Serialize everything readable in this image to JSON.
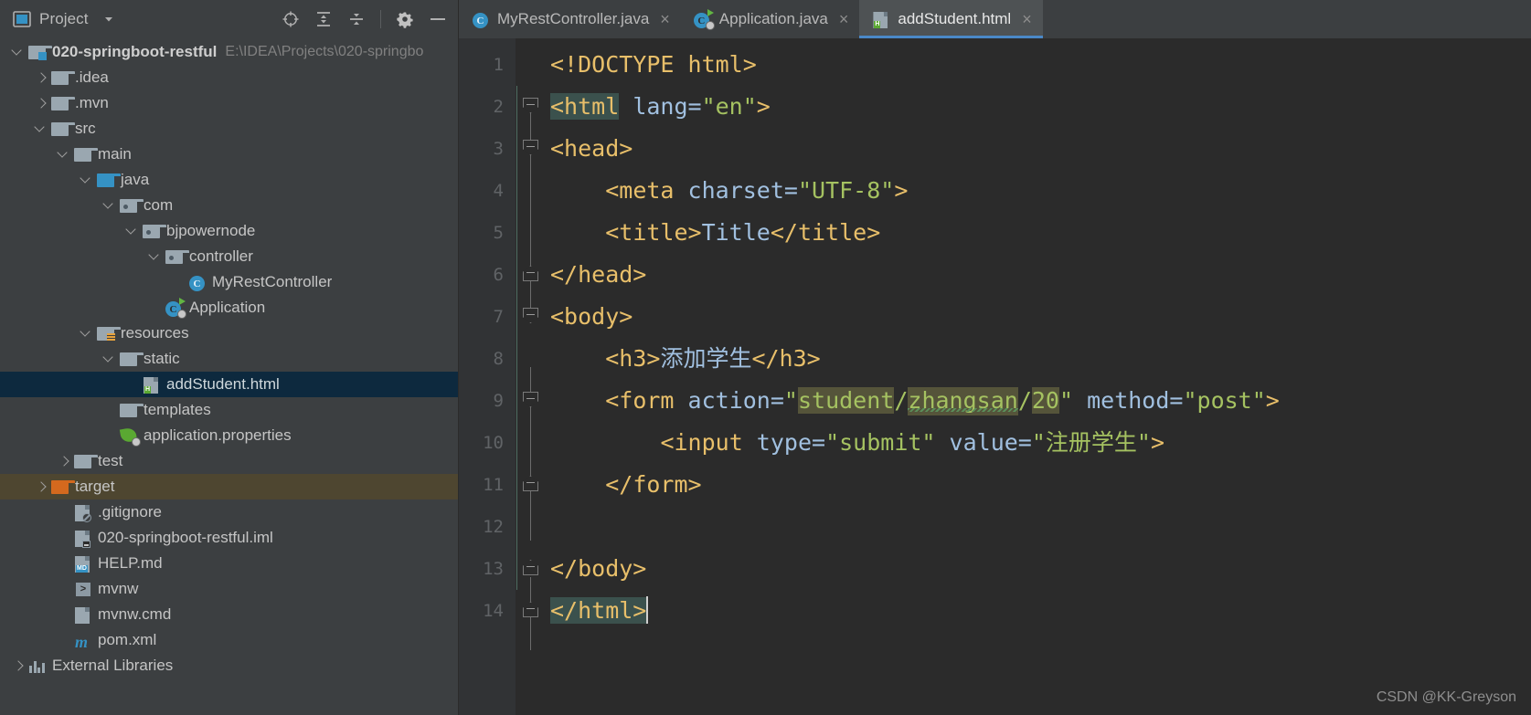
{
  "panel": {
    "title": "Project",
    "dropdown_icon": "chevron-down-icon",
    "tools": [
      {
        "name": "locate-icon",
        "label": "Select Opened File"
      },
      {
        "name": "expand-all-icon",
        "label": "Expand All"
      },
      {
        "name": "collapse-all-icon",
        "label": "Collapse All"
      },
      {
        "name": "gear-icon",
        "label": "Settings"
      },
      {
        "name": "minimize-icon",
        "label": "Hide"
      }
    ]
  },
  "tree": [
    {
      "label": "020-springboot-restful",
      "path": "E:\\IDEA\\Projects\\020-springbo",
      "indent": 0,
      "arrow": "expanded",
      "icon": "module-folder-icon",
      "bold": true,
      "state": "normal"
    },
    {
      "label": ".idea",
      "path": "",
      "indent": 1,
      "arrow": "collapsed",
      "icon": "folder-icon",
      "bold": false,
      "state": "normal"
    },
    {
      "label": ".mvn",
      "path": "",
      "indent": 1,
      "arrow": "collapsed",
      "icon": "folder-icon",
      "bold": false,
      "state": "normal"
    },
    {
      "label": "src",
      "path": "",
      "indent": 1,
      "arrow": "expanded",
      "icon": "folder-icon",
      "bold": false,
      "state": "normal"
    },
    {
      "label": "main",
      "path": "",
      "indent": 2,
      "arrow": "expanded",
      "icon": "folder-icon",
      "bold": false,
      "state": "normal"
    },
    {
      "label": "java",
      "path": "",
      "indent": 3,
      "arrow": "expanded",
      "icon": "source-folder-icon",
      "bold": false,
      "state": "normal"
    },
    {
      "label": "com",
      "path": "",
      "indent": 4,
      "arrow": "expanded",
      "icon": "package-icon",
      "bold": false,
      "state": "normal"
    },
    {
      "label": "bjpowernode",
      "path": "",
      "indent": 5,
      "arrow": "expanded",
      "icon": "package-icon",
      "bold": false,
      "state": "normal"
    },
    {
      "label": "controller",
      "path": "",
      "indent": 6,
      "arrow": "expanded",
      "icon": "package-icon",
      "bold": false,
      "state": "normal"
    },
    {
      "label": "MyRestController",
      "path": "",
      "indent": 7,
      "arrow": "none",
      "icon": "java-class-icon",
      "bold": false,
      "state": "normal"
    },
    {
      "label": "Application",
      "path": "",
      "indent": 6,
      "arrow": "none",
      "icon": "spring-boot-class-icon",
      "bold": false,
      "state": "normal"
    },
    {
      "label": "resources",
      "path": "",
      "indent": 3,
      "arrow": "expanded",
      "icon": "resources-folder-icon",
      "bold": false,
      "state": "normal"
    },
    {
      "label": "static",
      "path": "",
      "indent": 4,
      "arrow": "expanded",
      "icon": "folder-icon",
      "bold": false,
      "state": "normal"
    },
    {
      "label": "addStudent.html",
      "path": "",
      "indent": 5,
      "arrow": "none",
      "icon": "html-file-icon",
      "bold": false,
      "state": "selected"
    },
    {
      "label": "templates",
      "path": "",
      "indent": 4,
      "arrow": "none",
      "icon": "folder-icon",
      "bold": false,
      "state": "normal"
    },
    {
      "label": "application.properties",
      "path": "",
      "indent": 4,
      "arrow": "none",
      "icon": "spring-properties-icon",
      "bold": false,
      "state": "normal"
    },
    {
      "label": "test",
      "path": "",
      "indent": 2,
      "arrow": "collapsed",
      "icon": "folder-icon",
      "bold": false,
      "state": "normal"
    },
    {
      "label": "target",
      "path": "",
      "indent": 1,
      "arrow": "collapsed",
      "icon": "excluded-folder-icon",
      "bold": false,
      "state": "highlighted"
    },
    {
      "label": ".gitignore",
      "path": "",
      "indent": 2,
      "arrow": "none",
      "icon": "gitignore-file-icon",
      "bold": false,
      "state": "normal"
    },
    {
      "label": "020-springboot-restful.iml",
      "path": "",
      "indent": 2,
      "arrow": "none",
      "icon": "iml-file-icon",
      "bold": false,
      "state": "normal"
    },
    {
      "label": "HELP.md",
      "path": "",
      "indent": 2,
      "arrow": "none",
      "icon": "markdown-file-icon",
      "bold": false,
      "state": "normal"
    },
    {
      "label": "mvnw",
      "path": "",
      "indent": 2,
      "arrow": "none",
      "icon": "shell-script-icon",
      "bold": false,
      "state": "normal"
    },
    {
      "label": "mvnw.cmd",
      "path": "",
      "indent": 2,
      "arrow": "none",
      "icon": "cmd-script-icon",
      "bold": false,
      "state": "normal"
    },
    {
      "label": "pom.xml",
      "path": "",
      "indent": 2,
      "arrow": "none",
      "icon": "maven-pom-icon",
      "bold": false,
      "state": "normal"
    },
    {
      "label": "External Libraries",
      "path": "",
      "indent": 0,
      "arrow": "collapsed",
      "icon": "external-libraries-icon",
      "bold": false,
      "state": "normal"
    }
  ],
  "tabs": [
    {
      "label": "MyRestController.java",
      "icon": "java-class-icon",
      "active": false,
      "close": "×"
    },
    {
      "label": "Application.java",
      "icon": "spring-boot-class-icon",
      "active": false,
      "close": "×"
    },
    {
      "label": "addStudent.html",
      "icon": "html-file-icon",
      "active": true,
      "close": "×"
    }
  ],
  "editor": {
    "line_numbers": [
      "1",
      "2",
      "3",
      "4",
      "5",
      "6",
      "7",
      "8",
      "9",
      "10",
      "11",
      "12",
      "13",
      "14"
    ],
    "lines": [
      "<!DOCTYPE html>",
      "<html lang=\"en\">",
      "<head>",
      "    <meta charset=\"UTF-8\">",
      "    <title>Title</title>",
      "</head>",
      "<body>",
      "    <h3>添加学生</h3>",
      "    <form action=\"student/zhangsan/20\" method=\"post\">",
      "        <input type=\"submit\" value=\"注册学生\">",
      "    </form>",
      "",
      "</body>",
      "</html>"
    ],
    "tokens": {
      "doctype": "<!DOCTYPE html>",
      "html_open_tag": "<html",
      "lang_attr": " lang=",
      "lang_value": "\"en\"",
      "gt": ">",
      "head_open": "<head>",
      "meta_indent": "    ",
      "meta_tag": "<meta",
      "charset_attr": " charset=",
      "charset_value": "\"UTF-8\"",
      "title_open": "<title>",
      "title_text": "Title",
      "title_close": "</title>",
      "head_close": "</head>",
      "body_open": "<body>",
      "h3_open": "<h3>",
      "h3_text": "添加学生",
      "h3_close": "</h3>",
      "form_tag": "<form",
      "action_attr": " action=",
      "quote": "\"",
      "url_seg1": "student",
      "url_slash": "/",
      "url_seg2": "zhangsan",
      "url_seg3": "20",
      "method_attr": " method=",
      "method_value": "\"post\"",
      "input_tag": "<input",
      "type_attr": " type=",
      "type_value": "\"submit\"",
      "value_attr": " value=",
      "value_value": "\"注册学生\"",
      "form_close": "</form>",
      "body_close": "</body>",
      "html_close": "</html>"
    },
    "caret_line": 14
  },
  "watermark": "CSDN @KK-Greyson",
  "colors": {
    "panel_bg": "#3c3f41",
    "editor_bg": "#2b2b2b",
    "gutter_bg": "#313335",
    "selection_blue": "#0d293e",
    "tag_orange": "#e8bf6a",
    "string_green": "#a5c261",
    "attr_blue": "#a1c0e0",
    "text_gray": "#a9b7c6",
    "accent_blue": "#4a88c7",
    "url_highlight": "#55543a",
    "brace_highlight": "#3b514d",
    "target_row": "#4e4630"
  }
}
